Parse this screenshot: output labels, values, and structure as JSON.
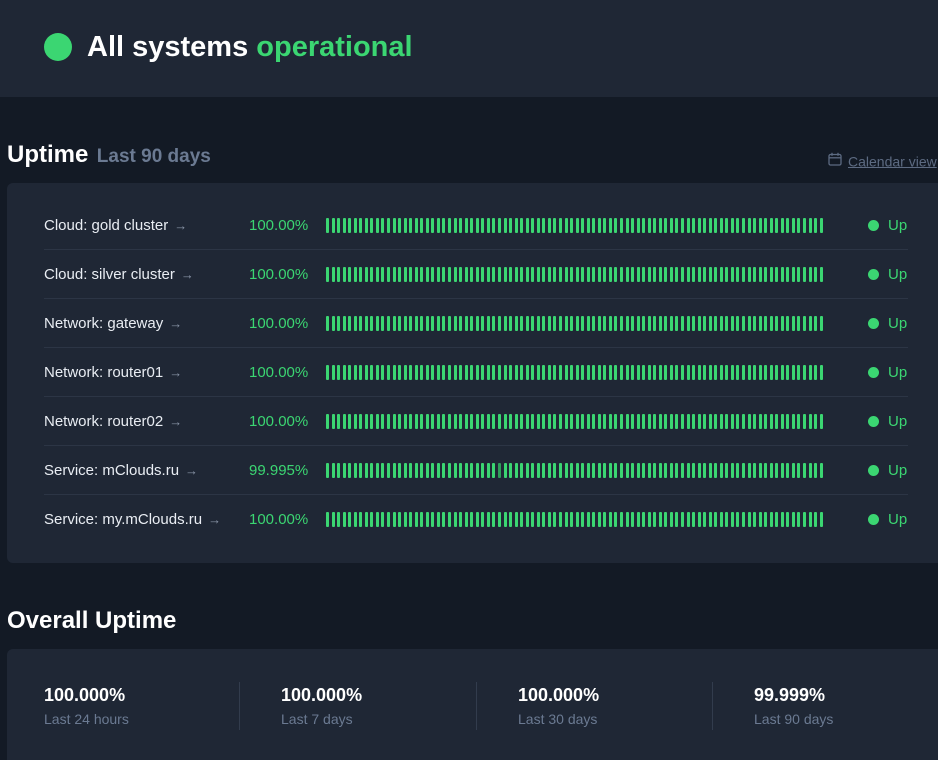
{
  "header": {
    "title_prefix": "All systems",
    "title_status": "operational",
    "status_color": "#3bd672"
  },
  "uptime": {
    "heading": "Uptime",
    "period": "Last 90 days",
    "calendar_link": "Calendar view",
    "calendar_icon": "calendar-icon",
    "bars_per_monitor": 90,
    "monitors": [
      {
        "name": "Cloud: gold cluster",
        "arrow": "→",
        "percentage": "100.00%",
        "status": "Up",
        "degraded_days": []
      },
      {
        "name": "Cloud: silver cluster",
        "arrow": "→",
        "percentage": "100.00%",
        "status": "Up",
        "degraded_days": []
      },
      {
        "name": "Network: gateway",
        "arrow": "→",
        "percentage": "100.00%",
        "status": "Up",
        "degraded_days": []
      },
      {
        "name": "Network: router01",
        "arrow": "→",
        "percentage": "100.00%",
        "status": "Up",
        "degraded_days": []
      },
      {
        "name": "Network: router02",
        "arrow": "→",
        "percentage": "100.00%",
        "status": "Up",
        "degraded_days": []
      },
      {
        "name": "Service: mClouds.ru",
        "arrow": "→",
        "percentage": "99.995%",
        "status": "Up",
        "degraded_days": [
          31
        ]
      },
      {
        "name": "Service: my.mClouds.ru",
        "arrow": "→",
        "percentage": "100.00%",
        "status": "Up",
        "degraded_days": []
      }
    ]
  },
  "overall": {
    "heading": "Overall Uptime",
    "items": [
      {
        "value": "100.000%",
        "label": "Last 24 hours"
      },
      {
        "value": "100.000%",
        "label": "Last 7 days"
      },
      {
        "value": "100.000%",
        "label": "Last 30 days"
      },
      {
        "value": "99.999%",
        "label": "Last 90 days"
      }
    ]
  }
}
